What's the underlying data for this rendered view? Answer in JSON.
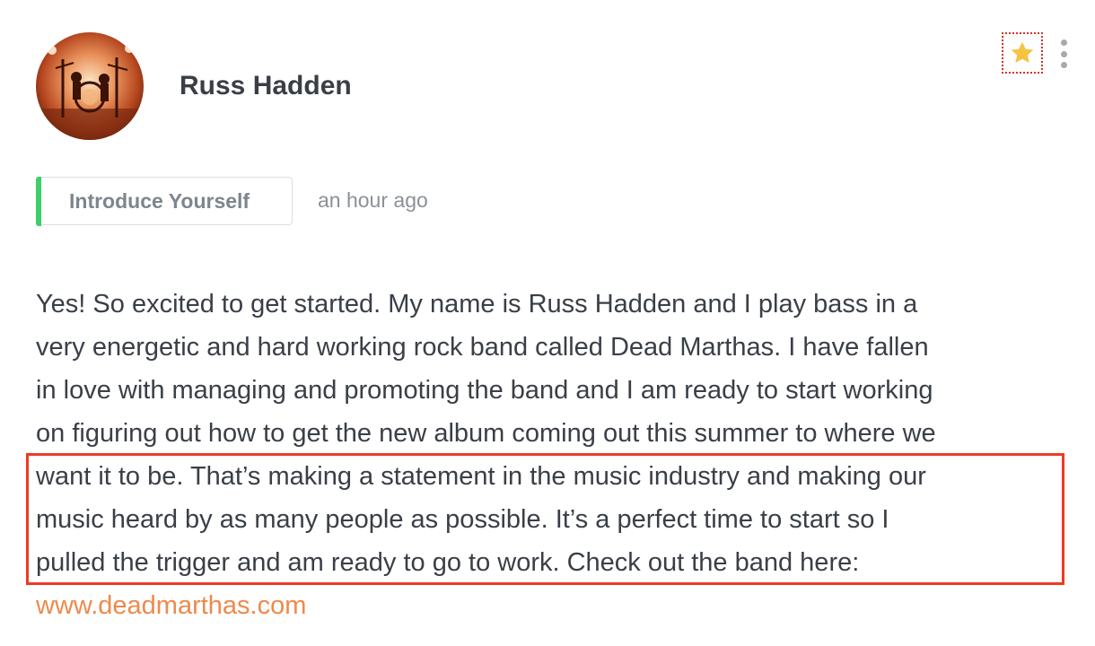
{
  "post": {
    "author": {
      "name": "Russ Hadden",
      "avatar": "band-on-stage-photo"
    },
    "actions": {
      "star_icon": "star-icon",
      "star_color": "#f5c242",
      "more_icon": "more-vertical-icon"
    },
    "category": {
      "label": "Introduce Yourself",
      "accent_color": "#3ccf6a"
    },
    "timestamp": "an hour ago",
    "body": {
      "lines": [
        "Yes! So excited to get started. My name is Russ Hadden and I play bass in a",
        "very energetic and hard working rock band called Dead Marthas. I have fallen",
        "in love with managing and promoting the band and I am ready to start working",
        "on figuring out how to get the new album coming out this summer to where we",
        "want it to be. That’s making a statement in the music industry and making our",
        "music heard by as many people as possible. It’s a perfect time to start so I",
        "pulled the trigger and am ready to go to work. Check out the band here:"
      ],
      "link_text": "www.deadmarthas.com",
      "link_color": "#ed8a4b"
    },
    "highlight_color": "#ee3a24"
  }
}
